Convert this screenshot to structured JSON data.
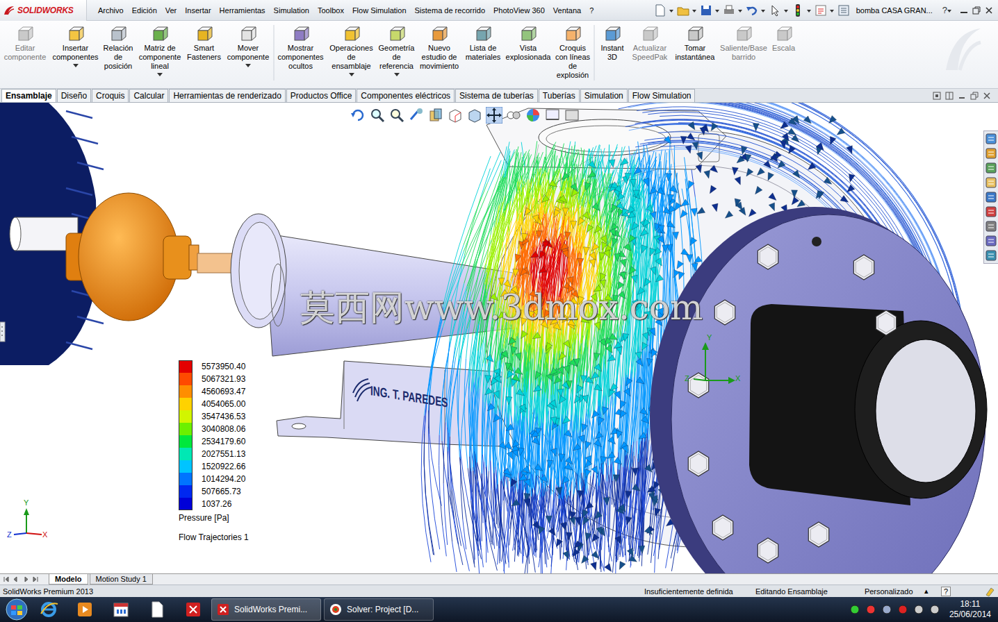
{
  "window": {
    "title": "bomba CASA GRAN...",
    "help": "?"
  },
  "app_logo": "SOLIDWORKS",
  "menu": [
    "Archivo",
    "Edición",
    "Ver",
    "Insertar",
    "Herramientas",
    "Simulation",
    "Toolbox",
    "Flow Simulation",
    "Sistema de recorrido",
    "PhotoView 360",
    "Ventana",
    "?"
  ],
  "ribbon": {
    "buttons": [
      {
        "label": "Editar componente",
        "disabled": true,
        "has_menu": false
      },
      {
        "label": "Insertar componentes",
        "disabled": false,
        "has_menu": true
      },
      {
        "label": "Relación de posición",
        "disabled": false,
        "has_menu": false
      },
      {
        "label": "Matriz de componente lineal",
        "disabled": false,
        "has_menu": true
      },
      {
        "label": "Smart Fasteners",
        "disabled": false,
        "has_menu": false
      },
      {
        "label": "Mover componente",
        "disabled": false,
        "has_menu": true
      },
      {
        "label": "Mostrar componentes ocultos",
        "disabled": false,
        "has_menu": false
      },
      {
        "label": "Operaciones de ensamblaje",
        "disabled": false,
        "has_menu": true
      },
      {
        "label": "Geometría de referencia",
        "disabled": false,
        "has_menu": true
      },
      {
        "label": "Nuevo estudio de movimiento",
        "disabled": false,
        "has_menu": false
      },
      {
        "label": "Lista de materiales",
        "disabled": false,
        "has_menu": false
      },
      {
        "label": "Vista explosionada",
        "disabled": false,
        "has_menu": false
      },
      {
        "label": "Croquis con líneas de explosión",
        "disabled": false,
        "has_menu": false
      },
      {
        "label": "Instant 3D",
        "disabled": false,
        "has_menu": false
      },
      {
        "label": "Actualizar SpeedPak",
        "disabled": true,
        "has_menu": false
      },
      {
        "label": "Tomar instantánea",
        "disabled": false,
        "has_menu": false
      },
      {
        "label": "Saliente/Base barrido",
        "disabled": true,
        "has_menu": false
      },
      {
        "label": "Escala",
        "disabled": true,
        "has_menu": false
      }
    ]
  },
  "command_tabs": [
    {
      "label": "Ensamblaje",
      "selected": true
    },
    {
      "label": "Diseño",
      "selected": false
    },
    {
      "label": "Croquis",
      "selected": false
    },
    {
      "label": "Calcular",
      "selected": false
    },
    {
      "label": "Herramientas de renderizado",
      "selected": false
    },
    {
      "label": "Productos Office",
      "selected": false
    },
    {
      "label": "Componentes eléctricos",
      "selected": false
    },
    {
      "label": "Sistema de tuberías",
      "selected": false
    },
    {
      "label": "Tuberías",
      "selected": false
    },
    {
      "label": "Simulation",
      "selected": false
    },
    {
      "label": "Flow Simulation",
      "selected": false
    }
  ],
  "viewport": {
    "watermark": "莫西网www.3dmox.com",
    "model_label": "ING. T. PAREDES",
    "legend": {
      "values": [
        {
          "value": "5573950.40",
          "color": "#e30000"
        },
        {
          "value": "5067321.93",
          "color": "#ff4a00"
        },
        {
          "value": "4560693.47",
          "color": "#ff8e00"
        },
        {
          "value": "4054065.00",
          "color": "#ffd200"
        },
        {
          "value": "3547436.53",
          "color": "#d2f500"
        },
        {
          "value": "3040808.06",
          "color": "#6cf000"
        },
        {
          "value": "2534179.60",
          "color": "#00e83c"
        },
        {
          "value": "2027551.13",
          "color": "#00e8b4"
        },
        {
          "value": "1520922.66",
          "color": "#00c4ff"
        },
        {
          "value": "1014294.20",
          "color": "#0074ff"
        },
        {
          "value": "507665.73",
          "color": "#0028f0"
        },
        {
          "value": "1037.26",
          "color": "#0000d8"
        }
      ],
      "quantity": "Pressure [Pa]",
      "plot_name": "Flow Trajectories 1"
    },
    "view_triad": {
      "x": "X",
      "y": "Y",
      "z": "Z"
    },
    "model_triad": {
      "x": "X",
      "y": "Y",
      "z": "Z"
    }
  },
  "bottom_tabs": [
    {
      "label": "Modelo",
      "selected": true
    },
    {
      "label": "Motion Study 1",
      "selected": false
    }
  ],
  "status_bar": {
    "app": "SolidWorks Premium 2013",
    "definition": "Insuficientemente definida",
    "mode": "Editando Ensamblaje",
    "units": "Personalizado",
    "units_arrow": "▴",
    "help": "?"
  },
  "taskbar": {
    "tasks": [
      {
        "label": "SolidWorks Premi...",
        "active": true
      },
      {
        "label": "Solver: Project [D...",
        "active": false
      }
    ],
    "clock": {
      "time": "18:11",
      "date": "25/06/2014"
    }
  }
}
